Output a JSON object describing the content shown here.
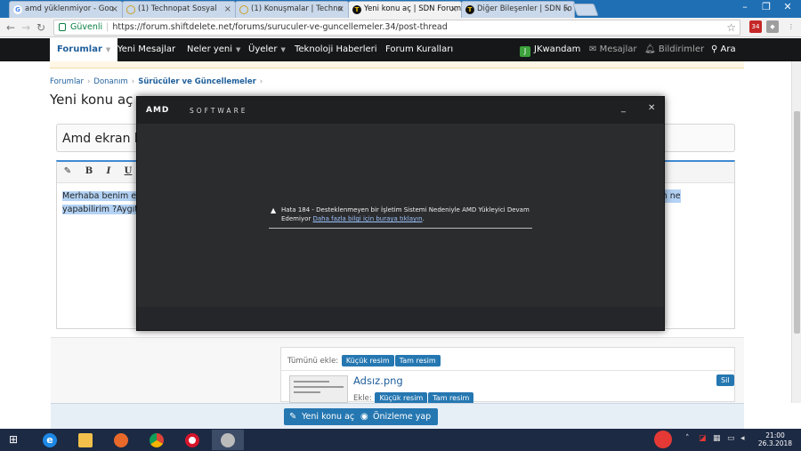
{
  "browser": {
    "tabs": [
      {
        "title": "amd yüklenmiyor - Goo",
        "favicon": "G",
        "fav_color": "#4285f4",
        "active": false
      },
      {
        "title": "(1) Technopat Sosyal",
        "favicon": "◯",
        "fav_color": "#c9a227",
        "active": false
      },
      {
        "title": "(1) Konuşmalar | Techno",
        "favicon": "◯",
        "fav_color": "#c9a227",
        "active": false
      },
      {
        "title": "Yeni konu aç | SDN Forum",
        "favicon": "T",
        "fav_color": "#111111",
        "active": true
      },
      {
        "title": "Diğer Bileşenler | SDN Fo",
        "favicon": "T",
        "fav_color": "#111111",
        "active": false
      }
    ],
    "address": {
      "secure_label": "Güvenli",
      "url": "https://forum.shiftdelete.net/forums/suruculer-ve-guncellemeler.34/post-thread"
    },
    "icons": [
      "back-arrow-icon",
      "forward-arrow-icon",
      "reload-icon",
      "lock-icon",
      "star-icon"
    ]
  },
  "site_nav": {
    "items": [
      "Forumlar",
      "Yeni Mesajlar",
      "Neler yeni",
      "Üyeler",
      "Teknoloji Haberleri",
      "Forum Kuralları"
    ],
    "user_initial": "J",
    "username": "JKwandam",
    "messages": "Mesajlar",
    "alerts": "Bildirimler",
    "search": "Ara"
  },
  "page": {
    "breadcrumb": [
      "Forumlar",
      "Donanım",
      "Sürücüler ve Güncellemeler"
    ],
    "title": "Yeni konu aç",
    "thread_title_value": "Amd ekran k",
    "editor_buttons": [
      "B",
      "I",
      "U"
    ],
    "editor_text_line1": "Merhaba benim ekr",
    "editor_text_line1_tail": "u alıyorum ne",
    "editor_text_line2": "yapabilirim ?Aygıt y",
    "attach": {
      "add_all_label": "Tümünü ekle:",
      "small_image": "Küçük resim",
      "full_image": "Tam resim",
      "file_name": "Adsız.png",
      "add_label": "Ekle:",
      "delete": "Sil"
    },
    "footer": {
      "post_button": "Yeni konu aç",
      "preview_button": "Önizleme yap"
    }
  },
  "amd_dialog": {
    "logo": "AMD",
    "subtitle": "SOFTWARE",
    "message_line1": "Hata 184 - Desteklenmeyen bir İşletim Sistemi Nedeniyle AMD Yükleyici Devam",
    "message_line2": "Edemiyor",
    "link_text": "Daha fazla bilgi için buraya tıklayın",
    "minimize": "_",
    "close": "✕"
  },
  "taskbar": {
    "apps": [
      "internet-explorer-icon",
      "file-explorer-icon",
      "firefox-icon",
      "chrome-icon",
      "opera-icon",
      "amd-installer-icon"
    ],
    "time": "21:00",
    "date": "26.3.2018"
  },
  "colors": {
    "accent": "#2577b1",
    "nav_bg": "#161718",
    "amd_bg": "#2b2c2e",
    "tab_strip": "#1f6fb4",
    "taskbar": "#1c2a44"
  }
}
